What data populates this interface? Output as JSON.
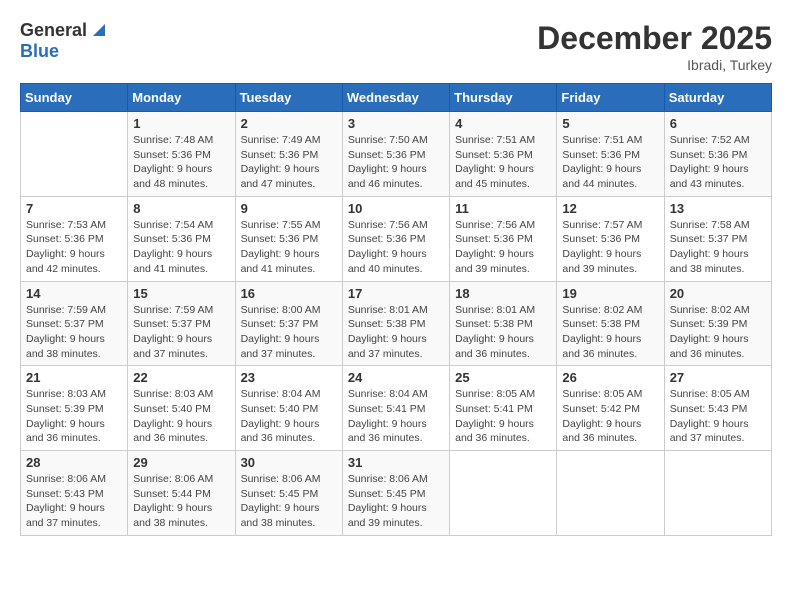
{
  "logo": {
    "general": "General",
    "blue": "Blue"
  },
  "title": "December 2025",
  "location": "Ibradi, Turkey",
  "days_of_week": [
    "Sunday",
    "Monday",
    "Tuesday",
    "Wednesday",
    "Thursday",
    "Friday",
    "Saturday"
  ],
  "weeks": [
    [
      {
        "day": "",
        "detail": ""
      },
      {
        "day": "1",
        "detail": "Sunrise: 7:48 AM\nSunset: 5:36 PM\nDaylight: 9 hours\nand 48 minutes."
      },
      {
        "day": "2",
        "detail": "Sunrise: 7:49 AM\nSunset: 5:36 PM\nDaylight: 9 hours\nand 47 minutes."
      },
      {
        "day": "3",
        "detail": "Sunrise: 7:50 AM\nSunset: 5:36 PM\nDaylight: 9 hours\nand 46 minutes."
      },
      {
        "day": "4",
        "detail": "Sunrise: 7:51 AM\nSunset: 5:36 PM\nDaylight: 9 hours\nand 45 minutes."
      },
      {
        "day": "5",
        "detail": "Sunrise: 7:51 AM\nSunset: 5:36 PM\nDaylight: 9 hours\nand 44 minutes."
      },
      {
        "day": "6",
        "detail": "Sunrise: 7:52 AM\nSunset: 5:36 PM\nDaylight: 9 hours\nand 43 minutes."
      }
    ],
    [
      {
        "day": "7",
        "detail": "Sunrise: 7:53 AM\nSunset: 5:36 PM\nDaylight: 9 hours\nand 42 minutes."
      },
      {
        "day": "8",
        "detail": "Sunrise: 7:54 AM\nSunset: 5:36 PM\nDaylight: 9 hours\nand 41 minutes."
      },
      {
        "day": "9",
        "detail": "Sunrise: 7:55 AM\nSunset: 5:36 PM\nDaylight: 9 hours\nand 41 minutes."
      },
      {
        "day": "10",
        "detail": "Sunrise: 7:56 AM\nSunset: 5:36 PM\nDaylight: 9 hours\nand 40 minutes."
      },
      {
        "day": "11",
        "detail": "Sunrise: 7:56 AM\nSunset: 5:36 PM\nDaylight: 9 hours\nand 39 minutes."
      },
      {
        "day": "12",
        "detail": "Sunrise: 7:57 AM\nSunset: 5:36 PM\nDaylight: 9 hours\nand 39 minutes."
      },
      {
        "day": "13",
        "detail": "Sunrise: 7:58 AM\nSunset: 5:37 PM\nDaylight: 9 hours\nand 38 minutes."
      }
    ],
    [
      {
        "day": "14",
        "detail": "Sunrise: 7:59 AM\nSunset: 5:37 PM\nDaylight: 9 hours\nand 38 minutes."
      },
      {
        "day": "15",
        "detail": "Sunrise: 7:59 AM\nSunset: 5:37 PM\nDaylight: 9 hours\nand 37 minutes."
      },
      {
        "day": "16",
        "detail": "Sunrise: 8:00 AM\nSunset: 5:37 PM\nDaylight: 9 hours\nand 37 minutes."
      },
      {
        "day": "17",
        "detail": "Sunrise: 8:01 AM\nSunset: 5:38 PM\nDaylight: 9 hours\nand 37 minutes."
      },
      {
        "day": "18",
        "detail": "Sunrise: 8:01 AM\nSunset: 5:38 PM\nDaylight: 9 hours\nand 36 minutes."
      },
      {
        "day": "19",
        "detail": "Sunrise: 8:02 AM\nSunset: 5:38 PM\nDaylight: 9 hours\nand 36 minutes."
      },
      {
        "day": "20",
        "detail": "Sunrise: 8:02 AM\nSunset: 5:39 PM\nDaylight: 9 hours\nand 36 minutes."
      }
    ],
    [
      {
        "day": "21",
        "detail": "Sunrise: 8:03 AM\nSunset: 5:39 PM\nDaylight: 9 hours\nand 36 minutes."
      },
      {
        "day": "22",
        "detail": "Sunrise: 8:03 AM\nSunset: 5:40 PM\nDaylight: 9 hours\nand 36 minutes."
      },
      {
        "day": "23",
        "detail": "Sunrise: 8:04 AM\nSunset: 5:40 PM\nDaylight: 9 hours\nand 36 minutes."
      },
      {
        "day": "24",
        "detail": "Sunrise: 8:04 AM\nSunset: 5:41 PM\nDaylight: 9 hours\nand 36 minutes."
      },
      {
        "day": "25",
        "detail": "Sunrise: 8:05 AM\nSunset: 5:41 PM\nDaylight: 9 hours\nand 36 minutes."
      },
      {
        "day": "26",
        "detail": "Sunrise: 8:05 AM\nSunset: 5:42 PM\nDaylight: 9 hours\nand 36 minutes."
      },
      {
        "day": "27",
        "detail": "Sunrise: 8:05 AM\nSunset: 5:43 PM\nDaylight: 9 hours\nand 37 minutes."
      }
    ],
    [
      {
        "day": "28",
        "detail": "Sunrise: 8:06 AM\nSunset: 5:43 PM\nDaylight: 9 hours\nand 37 minutes."
      },
      {
        "day": "29",
        "detail": "Sunrise: 8:06 AM\nSunset: 5:44 PM\nDaylight: 9 hours\nand 38 minutes."
      },
      {
        "day": "30",
        "detail": "Sunrise: 8:06 AM\nSunset: 5:45 PM\nDaylight: 9 hours\nand 38 minutes."
      },
      {
        "day": "31",
        "detail": "Sunrise: 8:06 AM\nSunset: 5:45 PM\nDaylight: 9 hours\nand 39 minutes."
      },
      {
        "day": "",
        "detail": ""
      },
      {
        "day": "",
        "detail": ""
      },
      {
        "day": "",
        "detail": ""
      }
    ]
  ]
}
